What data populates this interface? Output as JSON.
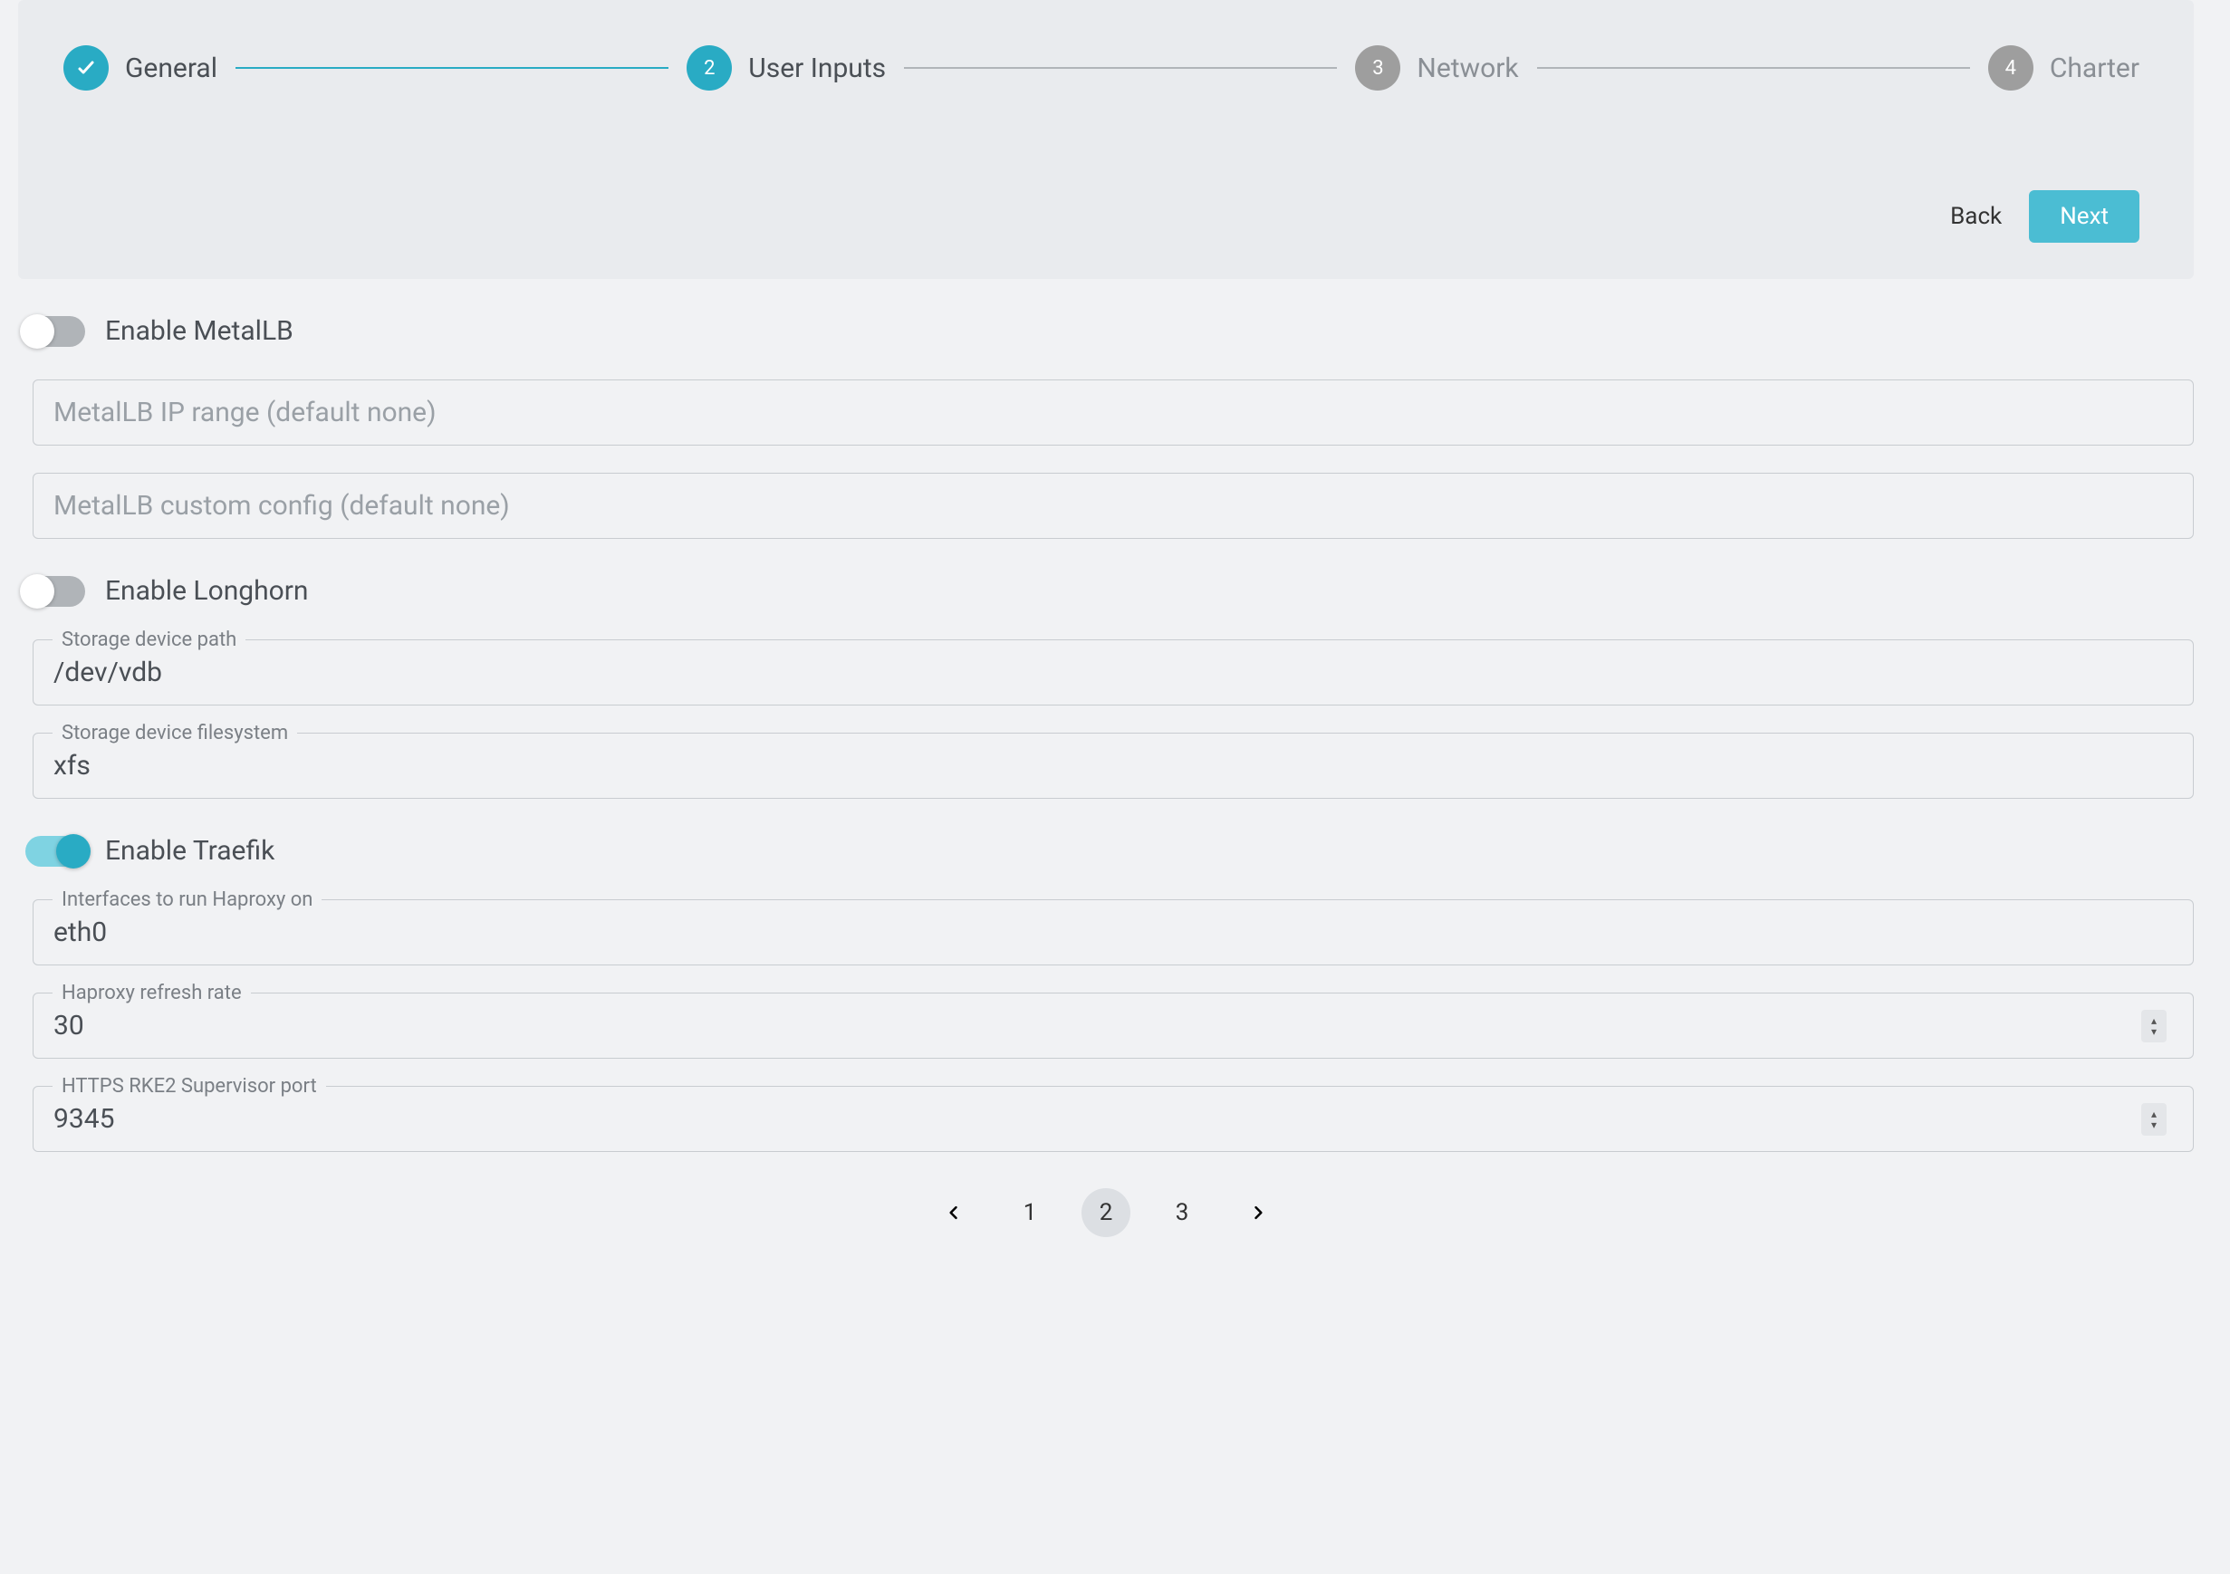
{
  "stepper": {
    "steps": [
      {
        "label": "General",
        "state": "done",
        "num": "✓"
      },
      {
        "label": "User Inputs",
        "state": "active",
        "num": "2"
      },
      {
        "label": "Network",
        "state": "pending",
        "num": "3"
      },
      {
        "label": "Charter",
        "state": "pending",
        "num": "4"
      }
    ],
    "back_label": "Back",
    "next_label": "Next"
  },
  "metallb": {
    "toggle_label": "Enable MetalLB",
    "enabled": false,
    "ip_range_placeholder": "MetalLB IP range (default none)",
    "ip_range_value": "",
    "config_placeholder": "MetalLB custom config (default none)",
    "config_value": ""
  },
  "longhorn": {
    "toggle_label": "Enable Longhorn",
    "enabled": false,
    "device_path_label": "Storage device path",
    "device_path_value": "/dev/vdb",
    "device_fs_label": "Storage device filesystem",
    "device_fs_value": "xfs"
  },
  "traefik": {
    "toggle_label": "Enable Traefik",
    "enabled": true,
    "haproxy_iface_label": "Interfaces to run Haproxy on",
    "haproxy_iface_value": "eth0",
    "haproxy_refresh_label": "Haproxy refresh rate",
    "haproxy_refresh_value": "30",
    "supervisor_port_label": "HTTPS RKE2 Supervisor port",
    "supervisor_port_value": "9345"
  },
  "pagination": {
    "pages": [
      "1",
      "2",
      "3"
    ],
    "current": "2"
  }
}
